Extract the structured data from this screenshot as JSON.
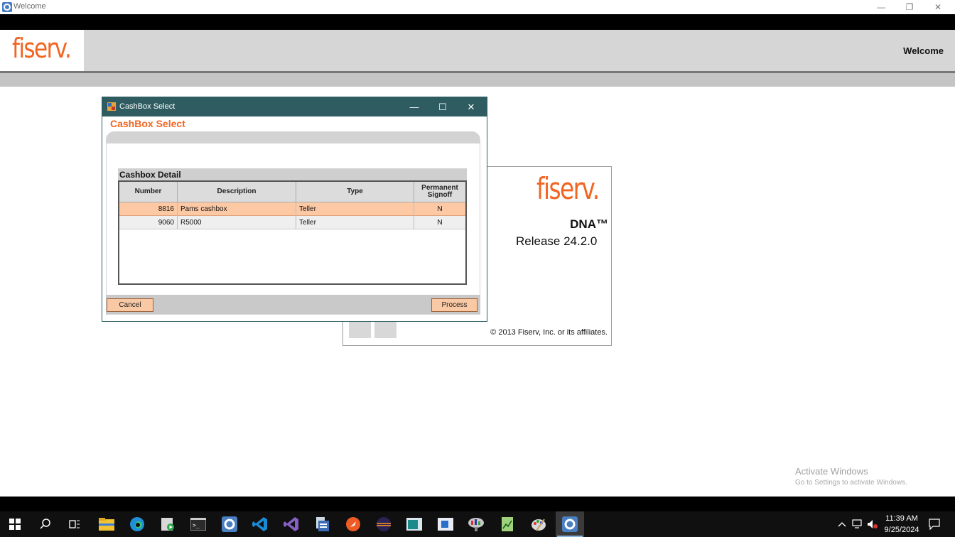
{
  "window": {
    "title": "Welcome",
    "controls": {
      "minimize": "—",
      "restore": "❐",
      "close": "✕"
    }
  },
  "app_header": {
    "logo": "fiserv.",
    "title": "Welcome"
  },
  "splash": {
    "logo": "fiserv.",
    "product": "DNA™",
    "release": "Release 24.2.0",
    "copyright": "© 2013 Fiserv, Inc. or its affiliates."
  },
  "dialog": {
    "window_title": "CashBox Select",
    "heading": "CashBox Select",
    "controls": {
      "minimize": "—",
      "maximize": "☐",
      "close": "✕"
    },
    "detail_header": "Cashbox Detail",
    "columns": [
      "Number",
      "Description",
      "Type",
      "Permanent Signoff"
    ],
    "rows": [
      {
        "number": "8816",
        "description": "Pams cashbox",
        "type": "Teller",
        "permanent_signoff": "N",
        "selected": true
      },
      {
        "number": "9060",
        "description": "R5000",
        "type": "Teller",
        "permanent_signoff": "N",
        "selected": false
      }
    ],
    "cancel_label": "Cancel",
    "process_label": "Process"
  },
  "watermark": {
    "title": "Activate Windows",
    "subtitle": "Go to Settings to activate Windows."
  },
  "taskbar": {
    "icons": [
      "start-icon",
      "search-icon",
      "task-view-icon",
      "file-explorer-icon",
      "edge-icon",
      "media-app-icon",
      "terminal-icon",
      "dna-app-icon",
      "vscode-icon",
      "visual-studio-icon",
      "document-app-icon",
      "postman-icon",
      "eclipse-icon",
      "window-app-icon",
      "blue-app-icon",
      "chart-app-icon",
      "notepad-app-icon",
      "paint-app-icon",
      "dna-active-app-icon"
    ],
    "time": "11:39 AM",
    "date": "9/25/2024"
  },
  "colors": {
    "brand_orange": "#f26522",
    "dialog_titlebar": "#2e5c61",
    "selected_row": "#fdc9a5",
    "button_fill": "#f9c8a4"
  }
}
